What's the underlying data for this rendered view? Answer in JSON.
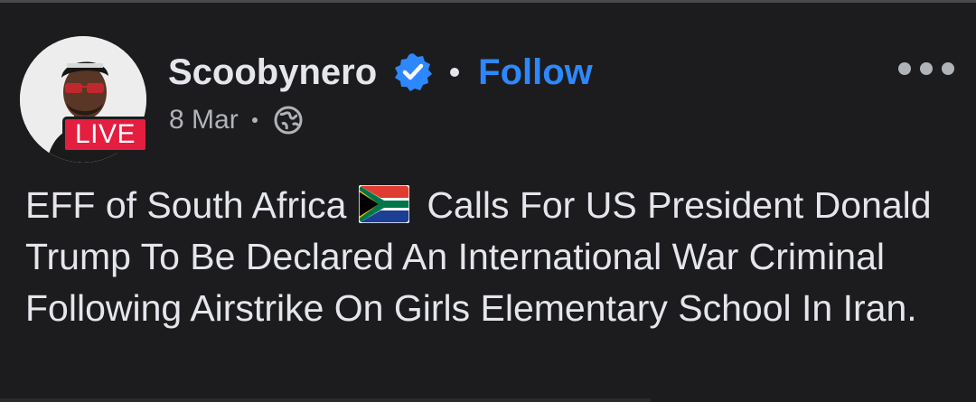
{
  "post": {
    "author": "Scoobynero",
    "follow_label": "Follow",
    "date": "8 Mar",
    "live_label": "LIVE",
    "verified_icon": "verified-badge-icon",
    "privacy_icon": "globe-icon",
    "more_icon": "more-options-icon",
    "text_before_flag": "EFF of South Africa",
    "flag_icon": "south-africa-flag-icon",
    "text_after_flag": "Calls For US President Donald Trump To Be Declared An International War Criminal Following Airstrike On Girls Elementary School In Iran."
  },
  "colors": {
    "background": "#1c1c1e",
    "primary_text": "#e4e6eb",
    "secondary_text": "#b0b3b8",
    "link_blue": "#2d88ff",
    "live_red": "#e41e3f"
  }
}
